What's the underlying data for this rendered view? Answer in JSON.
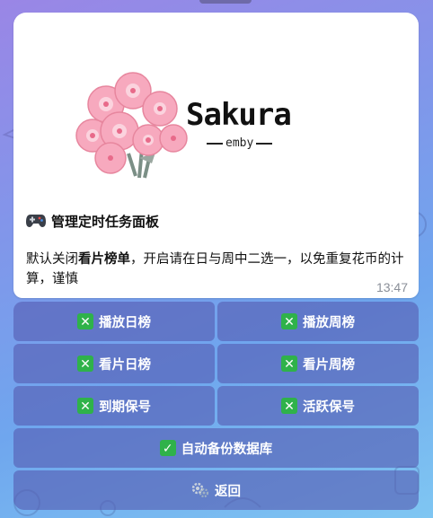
{
  "message": {
    "brand": {
      "title": "Sakura",
      "subtitle": "emby"
    },
    "title": "管理定时任务面板",
    "desc_1": "默认关闭",
    "desc_bold": "看片榜单",
    "desc_2": "，开启请在日与周中二选一，以免重复花币的计算，谨慎",
    "time": "13:47"
  },
  "keyboard": {
    "play_daily": "播放日榜",
    "play_weekly": "播放周榜",
    "watch_daily": "看片日榜",
    "watch_weekly": "看片周榜",
    "expire_keep": "到期保号",
    "active_keep": "活跃保号",
    "auto_backup": "自动备份数据库",
    "back": "返回"
  },
  "icons": {
    "off": "cross-mark-icon",
    "on": "check-mark-icon",
    "back": "gears-icon",
    "title": "gamepad-icon"
  },
  "colors": {
    "toggle_green": "#2fb24a",
    "button_bg": "#565cb2"
  }
}
